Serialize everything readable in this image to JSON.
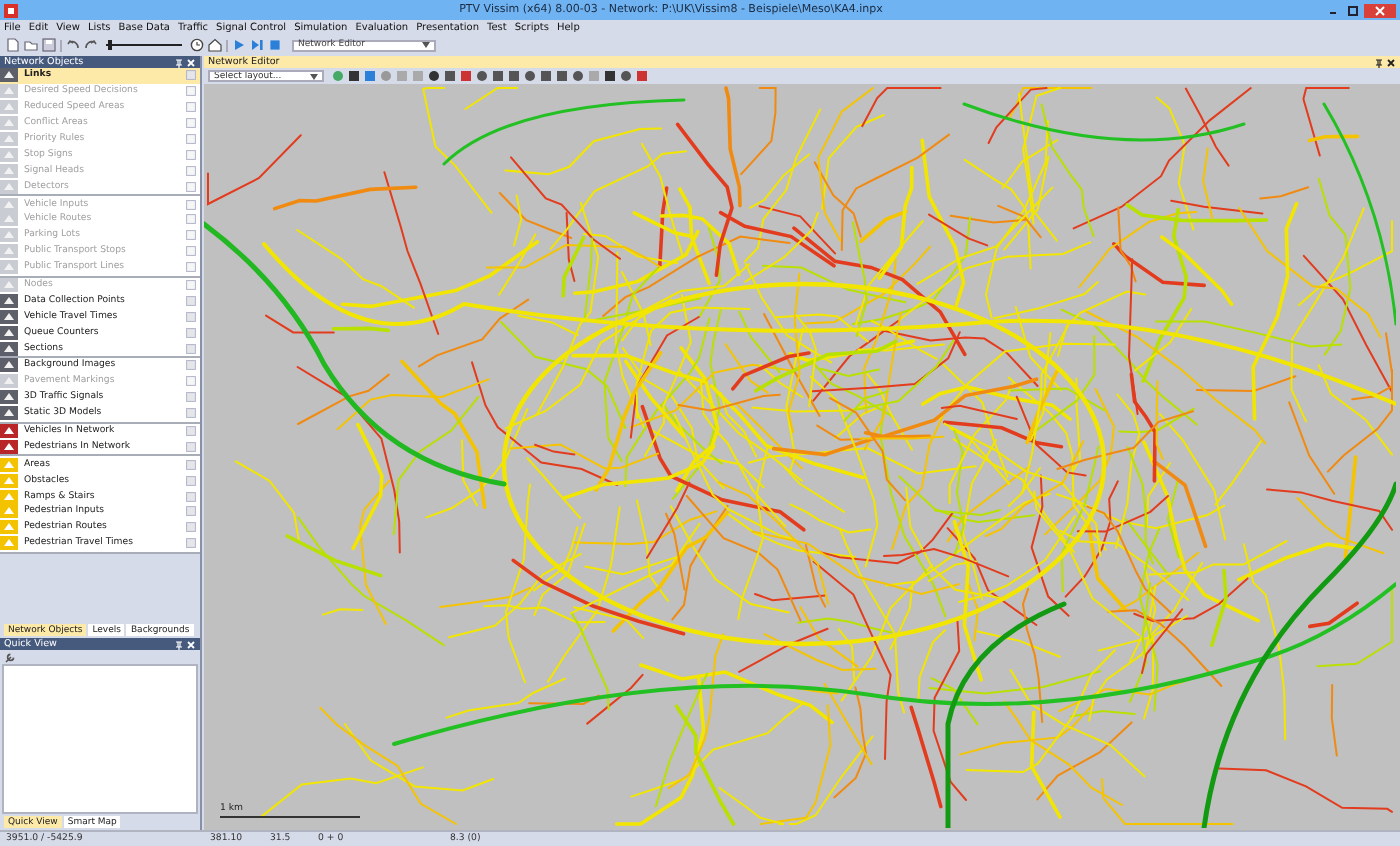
{
  "window": {
    "title": "PTV Vissim (x64) 8.00-03 - Network: P:\\UK\\Vissim8 - Beispiele\\Meso\\KA4.inpx"
  },
  "menu": [
    "File",
    "Edit",
    "View",
    "Lists",
    "Base Data",
    "Traffic",
    "Signal Control",
    "Simulation",
    "Evaluation",
    "Presentation",
    "Test",
    "Scripts",
    "Help"
  ],
  "toolbar": {
    "speed_slider": {
      "level": 0.05
    },
    "view_dropdown": "Network Editor"
  },
  "network_objects": {
    "title": "Network Objects",
    "groups": [
      {
        "kind": "standard",
        "items": [
          {
            "label": "Links",
            "selected": true,
            "dimmed": false
          },
          {
            "label": "Desired Speed Decisions",
            "selected": false,
            "dimmed": true
          },
          {
            "label": "Reduced Speed Areas",
            "selected": false,
            "dimmed": true
          },
          {
            "label": "Conflict Areas",
            "selected": false,
            "dimmed": true
          },
          {
            "label": "Priority Rules",
            "selected": false,
            "dimmed": true
          },
          {
            "label": "Stop Signs",
            "selected": false,
            "dimmed": true
          },
          {
            "label": "Signal Heads",
            "selected": false,
            "dimmed": true
          },
          {
            "label": "Detectors",
            "selected": false,
            "dimmed": true
          }
        ]
      },
      {
        "kind": "standard",
        "items": [
          {
            "label": "Vehicle Inputs",
            "selected": false,
            "dimmed": true
          },
          {
            "label": "Vehicle Routes",
            "selected": false,
            "dimmed": true
          },
          {
            "label": "Parking Lots",
            "selected": false,
            "dimmed": true
          },
          {
            "label": "Public Transport Stops",
            "selected": false,
            "dimmed": true
          },
          {
            "label": "Public Transport Lines",
            "selected": false,
            "dimmed": true
          }
        ]
      },
      {
        "kind": "standard",
        "items": [
          {
            "label": "Nodes",
            "selected": false,
            "dimmed": true
          },
          {
            "label": "Data Collection Points",
            "selected": false,
            "dimmed": false
          },
          {
            "label": "Vehicle Travel Times",
            "selected": false,
            "dimmed": false
          },
          {
            "label": "Queue Counters",
            "selected": false,
            "dimmed": false
          },
          {
            "label": "Sections",
            "selected": false,
            "dimmed": false
          }
        ]
      },
      {
        "kind": "standard",
        "items": [
          {
            "label": "Background Images",
            "selected": false,
            "dimmed": false
          },
          {
            "label": "Pavement Markings",
            "selected": false,
            "dimmed": true
          },
          {
            "label": "3D Traffic Signals",
            "selected": false,
            "dimmed": false
          },
          {
            "label": "Static 3D Models",
            "selected": false,
            "dimmed": false
          }
        ]
      },
      {
        "kind": "vehicles",
        "items": [
          {
            "label": "Vehicles In Network",
            "selected": false,
            "dimmed": false
          },
          {
            "label": "Pedestrians In Network",
            "selected": false,
            "dimmed": false
          }
        ]
      },
      {
        "kind": "pedestrians",
        "items": [
          {
            "label": "Areas",
            "selected": false,
            "dimmed": false
          },
          {
            "label": "Obstacles",
            "selected": false,
            "dimmed": false
          },
          {
            "label": "Ramps & Stairs",
            "selected": false,
            "dimmed": false
          },
          {
            "label": "Pedestrian Inputs",
            "selected": false,
            "dimmed": false
          },
          {
            "label": "Pedestrian Routes",
            "selected": false,
            "dimmed": false
          },
          {
            "label": "Pedestrian Travel Times",
            "selected": false,
            "dimmed": false
          }
        ]
      }
    ]
  },
  "left_tabs": [
    {
      "label": "Network Objects",
      "selected": true
    },
    {
      "label": "Levels",
      "selected": false
    },
    {
      "label": "Backgrounds",
      "selected": false
    }
  ],
  "quick_view": {
    "title": "Quick View",
    "tabs": [
      {
        "label": "Quick View",
        "selected": true
      },
      {
        "label": "Smart Map",
        "selected": false
      }
    ]
  },
  "network_editor": {
    "title": "Network Editor",
    "layout_select": {
      "placeholder": "Select layout..."
    },
    "scale_label": "1 km"
  },
  "status_bar": [
    "3951.0 / -5425.9",
    "381.10",
    "31.5",
    "0 + 0",
    "8.3 (0)"
  ]
}
